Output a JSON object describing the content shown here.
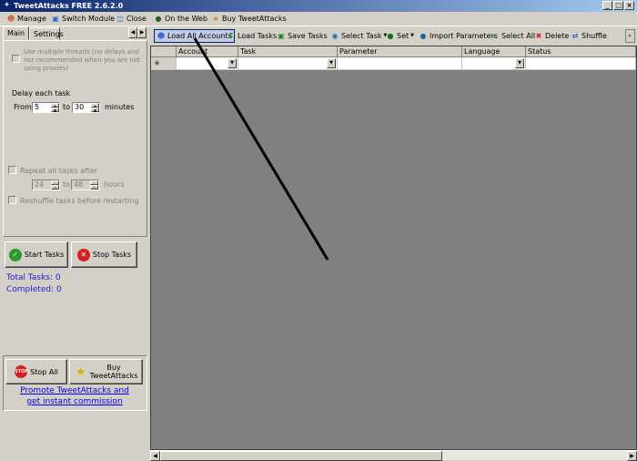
{
  "window": {
    "title": "TweetAttacks FREE 2.6.2.0",
    "controls": [
      "_",
      "□",
      "×"
    ]
  },
  "menu": [
    {
      "label": "Manage",
      "icon": "user-icon"
    },
    {
      "label": "Switch Module",
      "icon": "window-icon"
    },
    {
      "label": "Close",
      "icon": "close-window-icon"
    },
    {
      "label": "On the Web",
      "icon": "globe-icon"
    },
    {
      "label": "Buy TweetAttacks",
      "icon": "cart-icon"
    }
  ],
  "left": {
    "tabs": [
      "Main",
      "Settings"
    ],
    "multi_threads_label": "Use multiple threads (no delays and not recommended when you are not using proxies)",
    "delay_heading": "Delay each task",
    "from_label": "From",
    "to_label": "to",
    "from_value": "5",
    "to_value": "30",
    "minutes_label": "minutes",
    "repeat_label": "Repeat all tasks after",
    "repeat_from": "24",
    "repeat_to_label": "to",
    "repeat_to": "48",
    "hours_label": "hours",
    "reshuffle_label": "Reshuffle tasks before restarting",
    "start_button": "Start Tasks",
    "stop_button": "Stop Tasks",
    "total_tasks": "Total Tasks: 0",
    "completed": "Completed: 0",
    "stop_all_button": "Stop All",
    "buy_button_line1": "Buy",
    "buy_button_line2": "TweetAttacks",
    "promote_line1": "Promote TweetAttacks and",
    "promote_line2": "get instant commission"
  },
  "toolbar": [
    {
      "label": "Load All Accounts",
      "icon": "accounts-icon"
    },
    {
      "label": "Load Tasks",
      "icon": "download-icon"
    },
    {
      "label": "Save Tasks",
      "icon": "save-icon"
    },
    {
      "label": "Select Task",
      "icon": "select-icon"
    },
    {
      "label": "Set",
      "icon": "globe-icon"
    },
    {
      "label": "Import Parameters",
      "icon": "import-icon"
    },
    {
      "label": "Select All",
      "icon": "check-icon"
    },
    {
      "label": "Delete",
      "icon": "delete-icon"
    },
    {
      "label": "Shuffle",
      "icon": "shuffle-icon"
    }
  ],
  "grid": {
    "columns": [
      "Account",
      "Task",
      "Parameter",
      "Language",
      "Status"
    ],
    "new_row_marker": "✳"
  },
  "colors": {
    "title_start": "#0a246a",
    "title_end": "#a6caf0",
    "grid_bg": "#808080",
    "stat_text": "#1a1adc",
    "link": "#0000ee"
  }
}
